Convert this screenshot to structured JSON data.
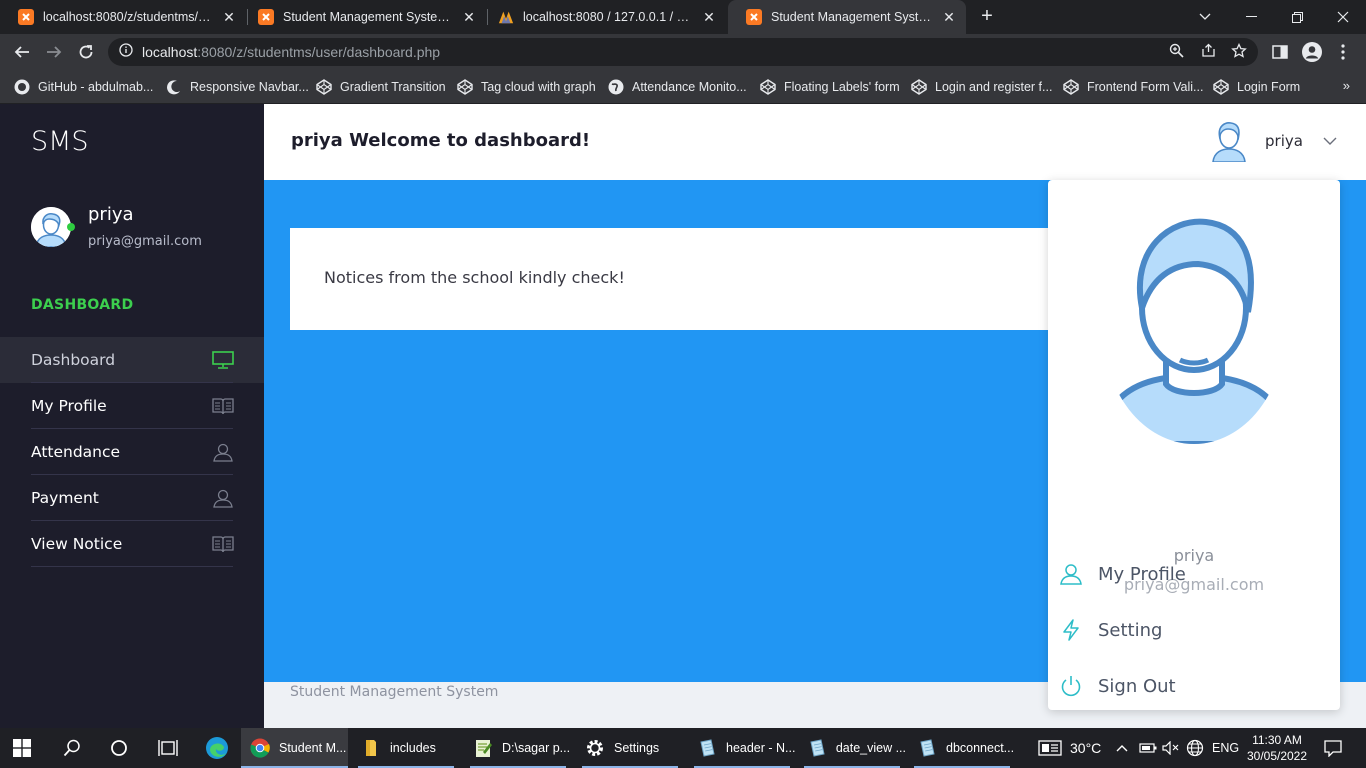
{
  "browser": {
    "tabs": [
      {
        "title": "localhost:8080/z/studentms/user/",
        "active": false
      },
      {
        "title": "Student Management System|||Da",
        "active": false
      },
      {
        "title": "localhost:8080 / 127.0.0.1 / stude",
        "active": false
      },
      {
        "title": "Student Management System|||Da",
        "active": true
      }
    ],
    "new_tab": "+",
    "url_host": "localhost",
    "url_rest": ":8080/z/studentms/user/dashboard.php",
    "bookmarks": [
      "GitHub - abdulmab...",
      "Responsive Navbar...",
      "Gradient Transition",
      "Tag cloud with graph",
      "Attendance Monito...",
      "Floating Labels' form",
      "Login and register f...",
      "Frontend Form Vali...",
      "Login Form"
    ],
    "bookmarks_more": "»"
  },
  "sidebar": {
    "brand": "SMS",
    "user_name": "priya",
    "user_email": "priya@gmail.com",
    "section_label": "DASHBOARD",
    "items": [
      {
        "label": "Dashboard",
        "icon": "monitor-icon",
        "active": true
      },
      {
        "label": "My Profile",
        "icon": "book-icon",
        "active": false
      },
      {
        "label": "Attendance",
        "icon": "user-icon",
        "active": false
      },
      {
        "label": "Payment",
        "icon": "user-icon",
        "active": false
      },
      {
        "label": "View Notice",
        "icon": "book-icon",
        "active": false
      }
    ]
  },
  "header": {
    "welcome": "priya Welcome to dashboard!",
    "user_name": "priya"
  },
  "main": {
    "notice": "Notices from the school kindly check!"
  },
  "footer": {
    "text": "Student Management System"
  },
  "dropdown": {
    "name": "priya",
    "email": "priya@gmail.com",
    "items": [
      {
        "label": "My Profile",
        "icon": "user-icon"
      },
      {
        "label": "Setting",
        "icon": "bolt-icon"
      },
      {
        "label": "Sign Out",
        "icon": "power-icon"
      }
    ]
  },
  "taskbar": {
    "apps": [
      {
        "label": "Student M...",
        "icon": "chrome-icon"
      },
      {
        "label": "includes",
        "icon": "folder-icon"
      },
      {
        "label": "D:\\sagar p...",
        "icon": "notepadpp-icon"
      },
      {
        "label": "Settings",
        "icon": "gear-icon"
      },
      {
        "label": "header - N...",
        "icon": "notepad-icon"
      },
      {
        "label": "date_view ...",
        "icon": "notepad-icon"
      },
      {
        "label": "dbconnect...",
        "icon": "notepad-icon"
      }
    ],
    "temperature": "30°C",
    "language": "ENG",
    "time": "11:30 AM",
    "date": "30/05/2022"
  },
  "colors": {
    "sidebar_bg": "#1d1d2b",
    "accent_green": "#3ccf4e",
    "main_blue": "#2196f3",
    "dropdown_icon": "#2dbdc8"
  }
}
